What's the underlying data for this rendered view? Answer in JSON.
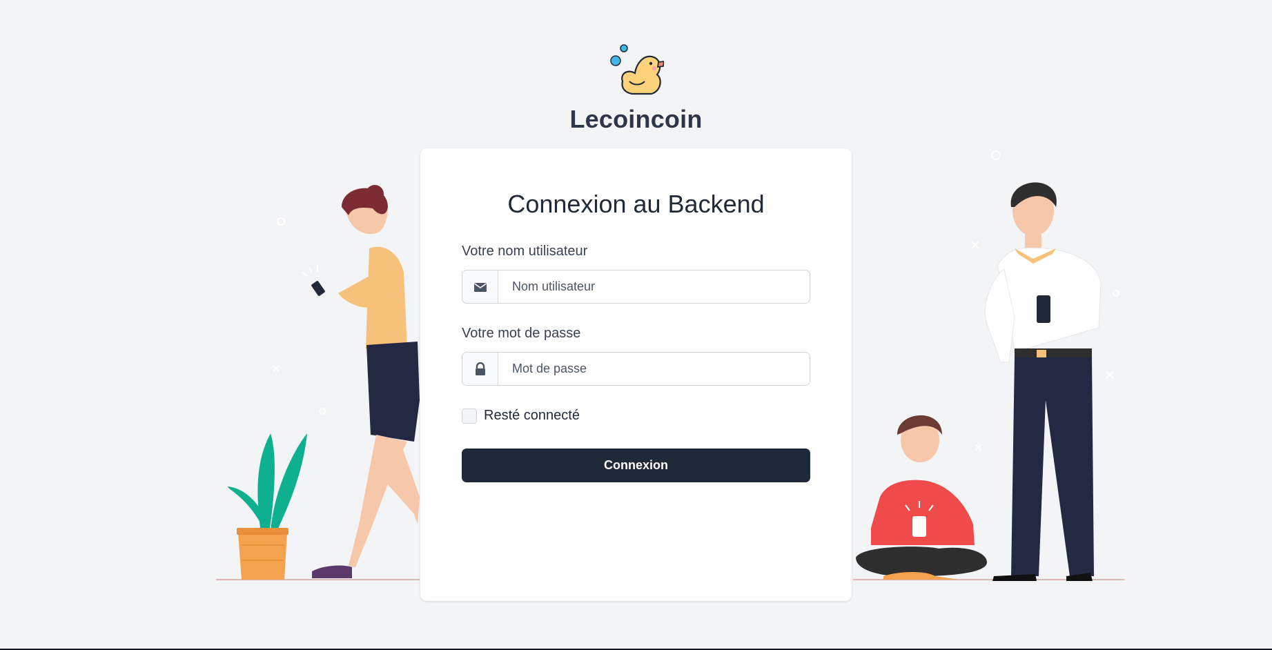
{
  "brand": {
    "name": "Lecoincoin",
    "logo_icon": "duck-logo-icon"
  },
  "login": {
    "title": "Connexion au Backend",
    "username": {
      "label": "Votre nom utilisateur",
      "placeholder": "Nom utilisateur",
      "value": "",
      "icon": "envelope-icon"
    },
    "password": {
      "label": "Votre mot de passe",
      "placeholder": "Mot de passe",
      "value": "",
      "icon": "lock-icon"
    },
    "remember_me": {
      "label": "Resté connecté",
      "checked": false
    },
    "submit_label": "Connexion"
  },
  "colors": {
    "background": "#f3f4f6",
    "card": "#ffffff",
    "primary_button": "#1f2937",
    "duck": "#fcd37a",
    "plant_pot": "#f4a24d",
    "plant_leaf": "#0fb08f",
    "sweater_red": "#ef4b4b",
    "top_yellow": "#f6c27a",
    "pants_navy": "#232943"
  }
}
